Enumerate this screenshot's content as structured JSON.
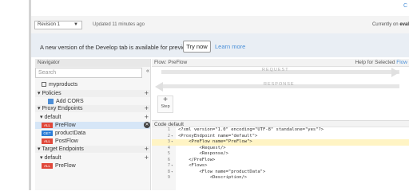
{
  "header": {
    "top_link": "C",
    "revision": "Revision 1",
    "updated": "Updated 11 minutes ago",
    "currently_prefix": "Currently on",
    "currently_env": "eval"
  },
  "banner": {
    "text": "A new version of the Develop tab is available for preview",
    "try_now": "Try now",
    "learn_more": "Learn more"
  },
  "navigator": {
    "title": "Navigator",
    "search_placeholder": "Search",
    "collapse": "«",
    "proxy_name": "myproducts",
    "policies_label": "Policies",
    "policy_item": "Add CORS",
    "proxy_endpoints_label": "Proxy Endpoints",
    "endpoint_default": "default",
    "preflow": "PreFlow",
    "conditional_flow": "productData",
    "postflow": "PostFlow",
    "target_endpoints_label": "Target Endpoints",
    "target_default": "default",
    "target_preflow": "PreFlow",
    "badge_all": "ALL",
    "badge_get": "GET"
  },
  "flow": {
    "title": "Flow: PreFlow",
    "help_prefix": "Help for Selected",
    "help_link": "Flow",
    "request_label": "REQUEST",
    "response_label": "RESPONSE",
    "step_label": "Step",
    "step_plus": "+"
  },
  "code": {
    "title": "Code",
    "endpoint": "default",
    "lines": [
      {
        "n": "1",
        "text": "<?xml version=\"1.0\" encoding=\"UTF-8\" standalone=\"yes\"?>"
      },
      {
        "n": "2",
        "text": "<ProxyEndpoint name=\"default\">"
      },
      {
        "n": "3",
        "text": "    <PreFlow name=\"PreFlow\">"
      },
      {
        "n": "4",
        "text": "        <Request/>"
      },
      {
        "n": "5",
        "text": "        <Response/>"
      },
      {
        "n": "6",
        "text": "    </PreFlow>"
      },
      {
        "n": "7",
        "text": "    <Flows>"
      },
      {
        "n": "8",
        "text": "        <Flow name=\"productData\">"
      },
      {
        "n": "9",
        "text": "            <Description/>"
      }
    ]
  }
}
